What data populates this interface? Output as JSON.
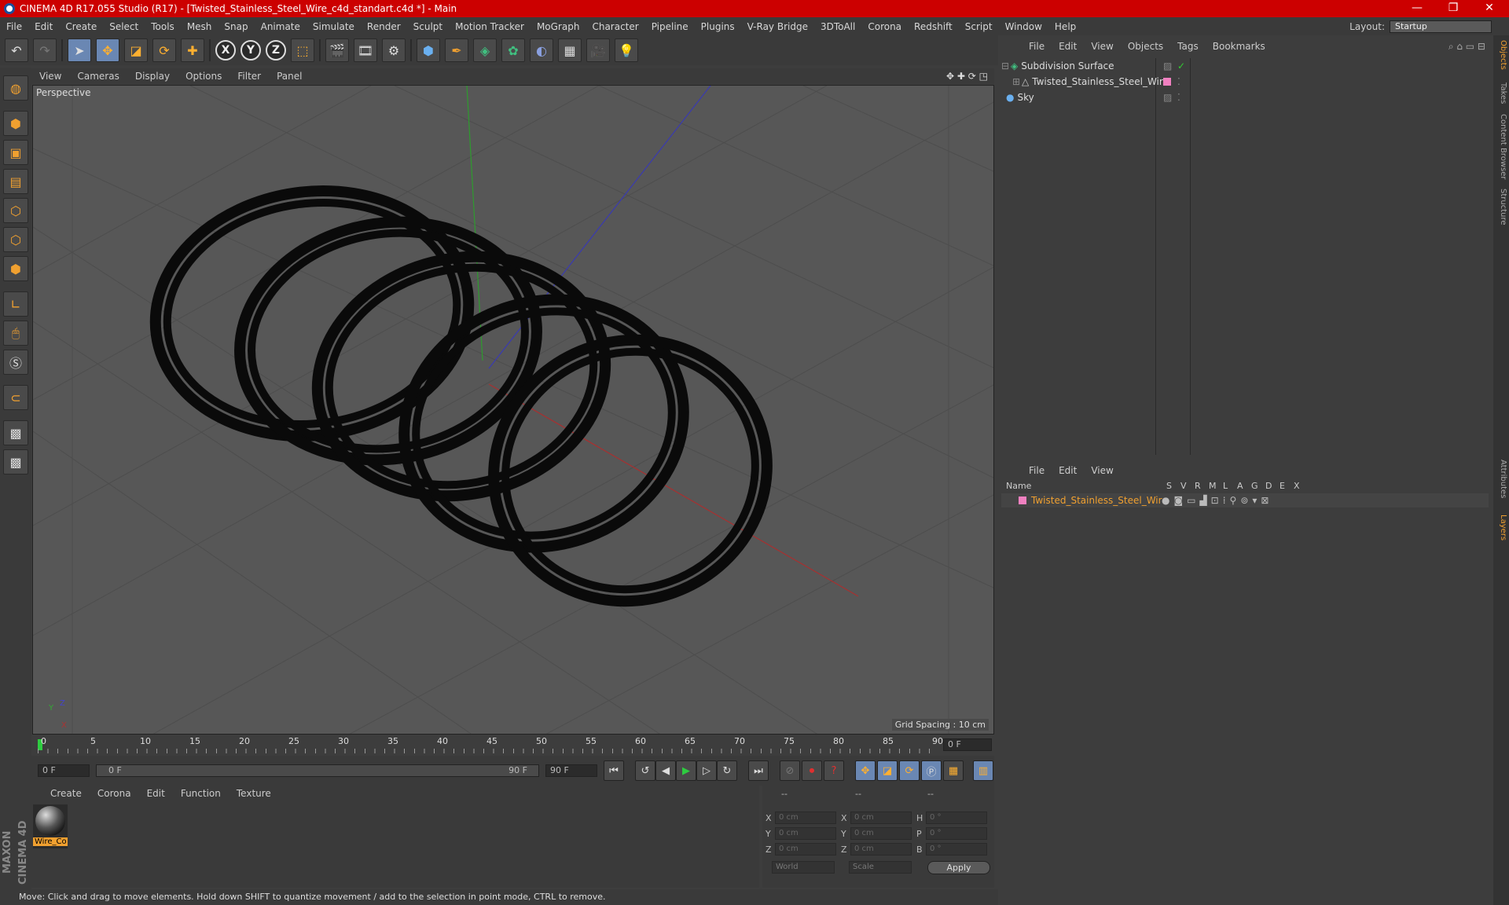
{
  "titlebar": {
    "title": "CINEMA 4D R17.055 Studio (R17) - [Twisted_Stainless_Steel_Wire_c4d_standart.c4d *] - Main",
    "minimize": "—",
    "restore": "❐",
    "close": "✕"
  },
  "menu": [
    "File",
    "Edit",
    "Create",
    "Select",
    "Tools",
    "Mesh",
    "Snap",
    "Animate",
    "Simulate",
    "Render",
    "Sculpt",
    "Motion Tracker",
    "MoGraph",
    "Character",
    "Pipeline",
    "Plugins",
    "V-Ray Bridge",
    "3DToAll",
    "Corona",
    "Redshift",
    "Script",
    "Window",
    "Help"
  ],
  "layout": {
    "label": "Layout:",
    "value": "Startup"
  },
  "viewport": {
    "menu": [
      "View",
      "Cameras",
      "Display",
      "Options",
      "Filter",
      "Panel"
    ],
    "label": "Perspective",
    "grid_spacing": "Grid Spacing : 10 cm",
    "axis_y": "Y",
    "axis_x": "X",
    "axis_z": "Z"
  },
  "timeline": {
    "ticks": [
      "0",
      "5",
      "10",
      "15",
      "20",
      "25",
      "30",
      "35",
      "40",
      "45",
      "50",
      "55",
      "60",
      "65",
      "70",
      "75",
      "80",
      "85",
      "90"
    ],
    "current": "0 F"
  },
  "transport": {
    "start": "0 F",
    "slider_start": "0 F",
    "slider_end": "90 F",
    "end": "90 F"
  },
  "material": {
    "menu": [
      "Create",
      "Corona",
      "Edit",
      "Function",
      "Texture"
    ],
    "item": "Wire_Co"
  },
  "coords": {
    "headers": [
      "--",
      "--",
      "--"
    ],
    "rows": [
      {
        "a": "X",
        "av": "0 cm",
        "b": "X",
        "bv": "0 cm",
        "c": "H",
        "cv": "0 °"
      },
      {
        "a": "Y",
        "av": "0 cm",
        "b": "Y",
        "bv": "0 cm",
        "c": "P",
        "cv": "0 °"
      },
      {
        "a": "Z",
        "av": "0 cm",
        "b": "Z",
        "bv": "0 cm",
        "c": "B",
        "cv": "0 °"
      }
    ],
    "world": "World",
    "scale": "Scale",
    "apply": "Apply"
  },
  "objects": {
    "menu": [
      "File",
      "Edit",
      "View",
      "Objects",
      "Tags",
      "Bookmarks"
    ],
    "items": [
      "Subdivision Surface",
      "Twisted_Stainless_Steel_Wire",
      "Sky"
    ]
  },
  "layers": {
    "menu": [
      "File",
      "Edit",
      "View"
    ],
    "columns": [
      "Name",
      "S",
      "V",
      "R",
      "M",
      "L",
      "A",
      "G",
      "D",
      "E",
      "X"
    ],
    "item": "Twisted_Stainless_Steel_Wire"
  },
  "right_tabs": [
    "Objects",
    "Takes",
    "Content Browser",
    "Structure",
    "Attributes",
    "Layers"
  ],
  "status": "Move: Click and drag to move elements. Hold down SHIFT to quantize movement / add to the selection in point mode, CTRL to remove.",
  "brand": "MAXON CINEMA 4D"
}
